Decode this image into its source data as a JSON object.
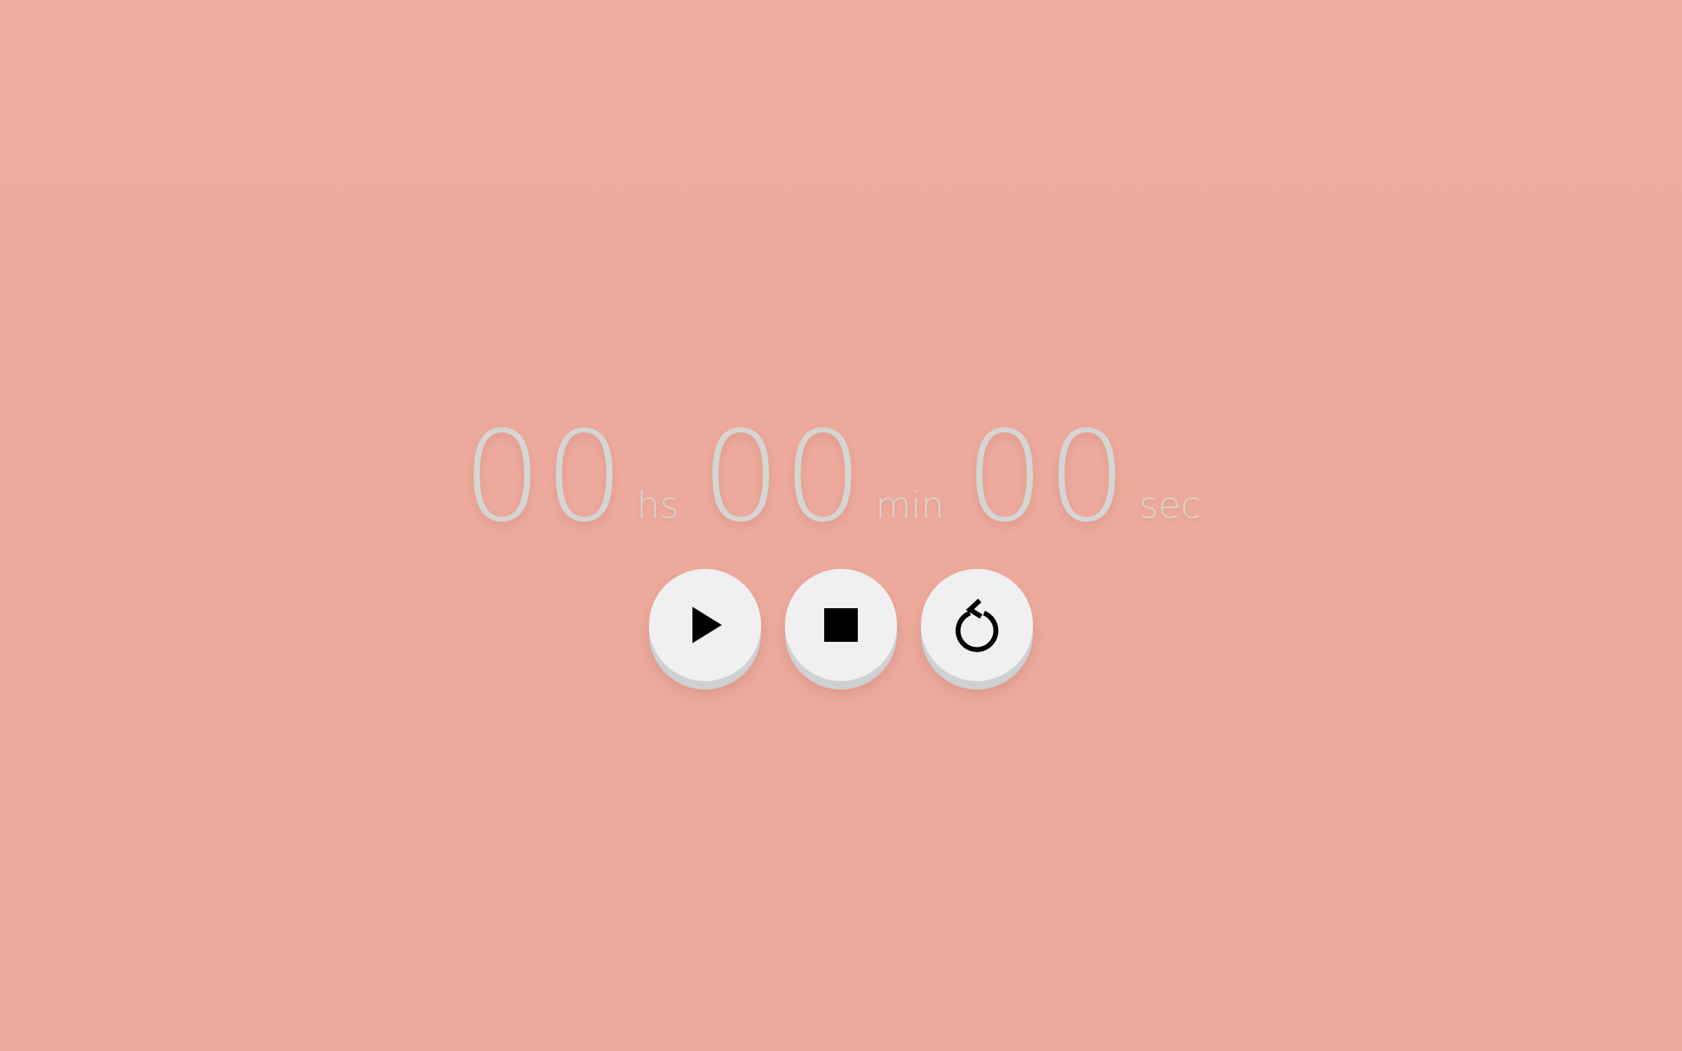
{
  "stopwatch": {
    "hours": "00",
    "hours_unit": "hs",
    "minutes": "00",
    "minutes_unit": "min",
    "seconds": "00",
    "seconds_unit": "sec"
  },
  "controls": {
    "play_icon": "play-icon",
    "stop_icon": "stop-icon",
    "reset_icon": "reset-icon"
  },
  "colors": {
    "background": "#eeaa9b",
    "digits": "#d6d5d3",
    "button_face": "#f0f0f0",
    "button_edge": "#cfd0d0",
    "icon": "#000000"
  }
}
